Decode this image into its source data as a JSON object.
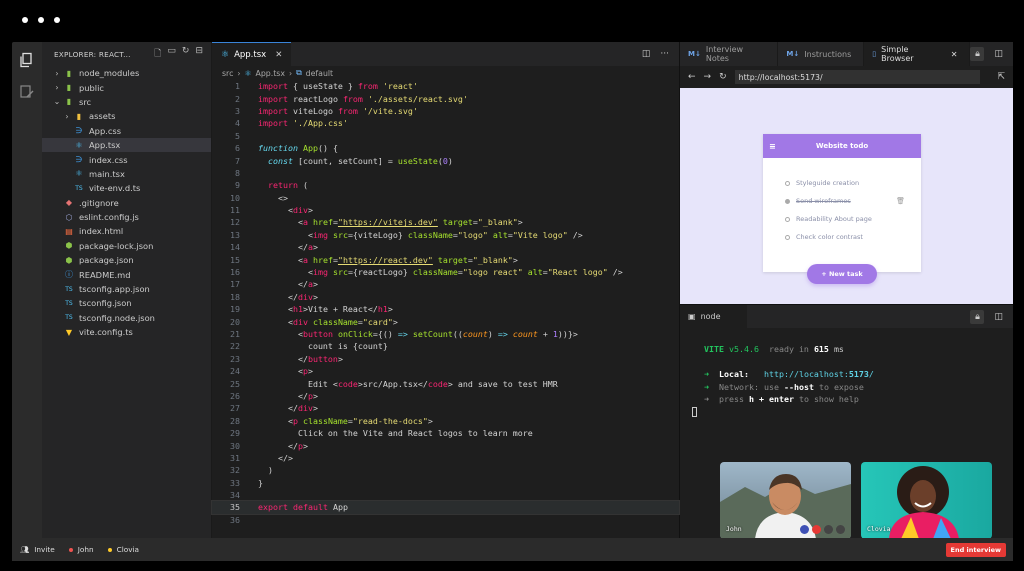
{
  "explorer": {
    "title": "EXPLORER: REACT...",
    "items": [
      {
        "label": "node_modules",
        "type": "folder",
        "depth": 0,
        "chev": "›",
        "color": "#8bc34a"
      },
      {
        "label": "public",
        "type": "folder",
        "depth": 0,
        "chev": "›",
        "color": "#8bc34a"
      },
      {
        "label": "src",
        "type": "folder",
        "depth": 0,
        "chev": "⌄",
        "color": "#8bc34a"
      },
      {
        "label": "assets",
        "type": "folder",
        "depth": 1,
        "chev": "›",
        "color": "#f0c040"
      },
      {
        "label": "App.css",
        "type": "css",
        "depth": 1,
        "chev": "",
        "color": "#42a5f5"
      },
      {
        "label": "App.tsx",
        "type": "tsx",
        "depth": 1,
        "chev": "",
        "color": "#4fc3f7",
        "selected": true
      },
      {
        "label": "index.css",
        "type": "css",
        "depth": 1,
        "chev": "",
        "color": "#42a5f5"
      },
      {
        "label": "main.tsx",
        "type": "tsx",
        "depth": 1,
        "chev": "",
        "color": "#4fc3f7"
      },
      {
        "label": "vite-env.d.ts",
        "type": "ts",
        "depth": 1,
        "chev": "",
        "color": "#4fc3f7"
      },
      {
        "label": ".gitignore",
        "type": "git",
        "depth": 0,
        "chev": "",
        "color": "#e57373"
      },
      {
        "label": "eslint.config.js",
        "type": "eslint",
        "depth": 0,
        "chev": "",
        "color": "#9fa8da"
      },
      {
        "label": "index.html",
        "type": "html",
        "depth": 0,
        "chev": "",
        "color": "#ff7043"
      },
      {
        "label": "package-lock.json",
        "type": "npm",
        "depth": 0,
        "chev": "",
        "color": "#8bc34a"
      },
      {
        "label": "package.json",
        "type": "npm",
        "depth": 0,
        "chev": "",
        "color": "#8bc34a"
      },
      {
        "label": "README.md",
        "type": "md",
        "depth": 0,
        "chev": "",
        "color": "#42a5f5"
      },
      {
        "label": "tsconfig.app.json",
        "type": "ts",
        "depth": 0,
        "chev": "",
        "color": "#4fc3f7"
      },
      {
        "label": "tsconfig.json",
        "type": "ts",
        "depth": 0,
        "chev": "",
        "color": "#4fc3f7"
      },
      {
        "label": "tsconfig.node.json",
        "type": "ts",
        "depth": 0,
        "chev": "",
        "color": "#4fc3f7"
      },
      {
        "label": "vite.config.ts",
        "type": "vite",
        "depth": 0,
        "chev": "",
        "color": "#ffca28"
      }
    ]
  },
  "editor": {
    "tab_label": "App.tsx",
    "breadcrumb": [
      "src",
      "App.tsx",
      "default"
    ],
    "current_line": 35
  },
  "right_tabs": [
    {
      "label": "Interview Notes",
      "icon": "M↓",
      "active": false
    },
    {
      "label": "Instructions",
      "icon": "M↓",
      "active": false
    },
    {
      "label": "Simple Browser",
      "icon": "▯",
      "active": true
    }
  ],
  "browser": {
    "url": "http://localhost:5173/",
    "todo_title": "Website todo",
    "todos": [
      {
        "label": "Styleguide creation",
        "done": false
      },
      {
        "label": "Send wireframes",
        "done": true
      },
      {
        "label": "Readability About page",
        "done": false
      },
      {
        "label": "Check color contrast",
        "done": false
      }
    ],
    "new_task_label": "+ New task"
  },
  "terminal": {
    "tab_label": "node",
    "vite_label": "VITE",
    "vite_version": "v5.4.6",
    "ready_text": "ready in",
    "ready_ms": "615",
    "ms_unit": "ms",
    "local_label": "Local:",
    "local_url_prefix": "http://localhost:",
    "local_port": "5173",
    "local_url_suffix": "/",
    "network_label": "Network:",
    "network_text": "use",
    "network_flag": "--host",
    "network_suffix": "to expose",
    "help_prefix": "press",
    "help_key": "h + enter",
    "help_suffix": "to show help"
  },
  "participants": [
    {
      "name": "John",
      "color": "#ef5350"
    },
    {
      "name": "Clovia",
      "color": "#ffca28"
    }
  ],
  "bottom": {
    "invite_label": "Invite",
    "end_label": "End interview"
  }
}
